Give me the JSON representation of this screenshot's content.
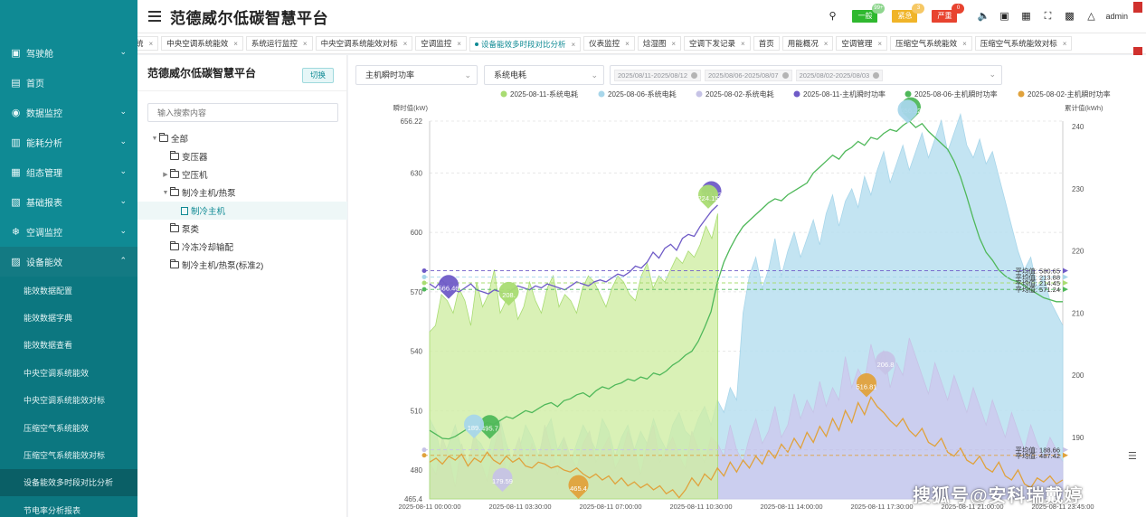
{
  "app": {
    "title": "范德威尔低碳智慧平台"
  },
  "header": {
    "badges": [
      {
        "label": "一般",
        "count": "99+",
        "color": "#2fb82f"
      },
      {
        "label": "紧急",
        "count": "3",
        "color": "#f0b428"
      },
      {
        "label": "严重",
        "count": "0",
        "color": "#e8432f"
      }
    ],
    "user": "admin"
  },
  "sidebar": {
    "items": [
      {
        "label": "驾驶舱",
        "icon": "dashboard-icon",
        "glyph": "▣",
        "expandable": true
      },
      {
        "label": "首页",
        "icon": "home-icon",
        "glyph": "▤",
        "expandable": false
      },
      {
        "label": "数据监控",
        "icon": "monitor-icon",
        "glyph": "◉",
        "expandable": true
      },
      {
        "label": "能耗分析",
        "icon": "bar-chart-icon",
        "glyph": "▥",
        "expandable": true
      },
      {
        "label": "组态管理",
        "icon": "grid-icon",
        "glyph": "▦",
        "expandable": true
      },
      {
        "label": "基础报表",
        "icon": "report-icon",
        "glyph": "▧",
        "expandable": true
      },
      {
        "label": "空调监控",
        "icon": "snowflake-icon",
        "glyph": "❄",
        "expandable": true
      },
      {
        "label": "设备能效",
        "icon": "efficiency-icon",
        "glyph": "▨",
        "expandable": true,
        "open": true
      }
    ],
    "subitems": [
      {
        "label": "能效数据配置"
      },
      {
        "label": "能效数据字典"
      },
      {
        "label": "能效数据查看"
      },
      {
        "label": "中央空调系统能效"
      },
      {
        "label": "中央空调系统能效对标"
      },
      {
        "label": "压缩空气系统能效"
      },
      {
        "label": "压缩空气系统能效对标"
      },
      {
        "label": "设备能效多时段对比分析",
        "active": true
      },
      {
        "label": "节电率分析报表"
      }
    ]
  },
  "tabs": [
    {
      "label": "统"
    },
    {
      "label": "中央空调系统能效"
    },
    {
      "label": "系统运行监控"
    },
    {
      "label": "中央空调系统能效对标"
    },
    {
      "label": "空调监控"
    },
    {
      "label": "设备能效多时段对比分析",
      "active": true
    },
    {
      "label": "仪表监控"
    },
    {
      "label": "焓湿图"
    },
    {
      "label": "空调下发记录"
    },
    {
      "label": "首页",
      "closable": false
    },
    {
      "label": "用能概况"
    },
    {
      "label": "空调管理"
    },
    {
      "label": "压缩空气系统能效"
    },
    {
      "label": "压缩空气系统能效对标"
    }
  ],
  "tree": {
    "title": "范德威尔低碳智慧平台",
    "switch_label": "切换",
    "search_placeholder": "输入搜索内容",
    "nodes": [
      {
        "label": "全部",
        "level": 0,
        "arrow": "▼",
        "type": "folder"
      },
      {
        "label": "变压器",
        "level": 1,
        "arrow": "",
        "type": "folder"
      },
      {
        "label": "空压机",
        "level": 1,
        "arrow": "▶",
        "type": "folder"
      },
      {
        "label": "制冷主机/热泵",
        "level": 1,
        "arrow": "▼",
        "type": "folder"
      },
      {
        "label": "制冷主机",
        "level": 2,
        "arrow": "",
        "type": "file",
        "selected": true
      },
      {
        "label": "泵类",
        "level": 1,
        "arrow": "",
        "type": "folder"
      },
      {
        "label": "冷冻冷却输配",
        "level": 1,
        "arrow": "",
        "type": "folder"
      },
      {
        "label": "制冷主机/热泵(标准2)",
        "level": 1,
        "arrow": "",
        "type": "folder"
      }
    ]
  },
  "filters": {
    "metric1": "主机瞬时功率",
    "metric2": "系统电耗",
    "periods": [
      "2025/08/11-2025/08/12",
      "2025/08/06-2025/08/07",
      "2025/08/02-2025/08/03"
    ]
  },
  "chart_data": {
    "type": "line",
    "left_axis": {
      "label": "瞬时值(kW)",
      "ticks": [
        465.4,
        480,
        510,
        540,
        570,
        600,
        630,
        656.22
      ],
      "min": 465.4,
      "max": 656.22
    },
    "right_axis": {
      "label": "累计值(kWh)",
      "ticks": [
        190,
        200,
        210,
        220,
        230,
        240
      ],
      "min": 180.1,
      "max": 240.9
    },
    "x_ticks": [
      "2025-08-11 00:00:00",
      "2025-08-11 03:30:00",
      "2025-08-11 07:00:00",
      "2025-08-11 10:30:00",
      "2025-08-11 14:00:00",
      "2025-08-11 17:30:00",
      "2025-08-11 21:00:00",
      "2025-08-11 23:45:00"
    ],
    "series": [
      {
        "name": "2025-08-11-系统电耗",
        "axis": "right",
        "style": "area",
        "color": "#a9dc72",
        "fill": "#cfeea4",
        "end": 0.455,
        "y": [
          207,
          208,
          213,
          212,
          210,
          214,
          212,
          208,
          215,
          211,
          213,
          217,
          210,
          212,
          214,
          209,
          211,
          215,
          212,
          210,
          214,
          216,
          211,
          213,
          212,
          210,
          214,
          216,
          215,
          213,
          211,
          214,
          216,
          215,
          213,
          212,
          216,
          218,
          214,
          216,
          215,
          217,
          219,
          218,
          220,
          219,
          221,
          224,
          222,
          226
        ]
      },
      {
        "name": "2025-08-06-系统电耗",
        "axis": "right",
        "style": "area",
        "color": "#a8d6ea",
        "fill": "#b9dff0",
        "y": [
          193,
          191,
          186,
          189,
          192,
          188,
          186,
          190,
          189,
          187,
          191,
          193,
          189,
          186,
          188,
          192,
          190,
          187,
          191,
          193,
          188,
          190,
          186,
          189,
          192,
          190,
          188,
          193,
          191,
          187,
          190,
          192,
          188,
          191,
          189,
          193,
          190,
          188,
          192,
          194,
          191,
          190,
          193,
          195,
          192,
          196,
          194,
          198,
          196,
          210,
          216,
          219,
          214,
          217,
          222,
          216,
          220,
          223,
          219,
          222,
          225,
          221,
          226,
          229,
          224,
          228,
          230,
          227,
          232,
          229,
          233,
          236,
          231,
          234,
          237,
          233,
          236,
          239,
          235,
          238,
          241,
          236,
          239,
          242,
          237,
          235,
          238,
          234,
          236,
          232,
          228,
          224,
          220,
          217,
          219,
          214,
          216,
          212,
          210,
          208
        ]
      },
      {
        "name": "2025-08-02-系统电耗",
        "axis": "right",
        "style": "area",
        "color": "#c6c3e6",
        "fill": "#cdcaee",
        "y": [
          186,
          184,
          190,
          187,
          182,
          189,
          185,
          191,
          186,
          183,
          188,
          192,
          184,
          187,
          190,
          185,
          189,
          186,
          192,
          188,
          184,
          190,
          187,
          185,
          189,
          191,
          186,
          188,
          190,
          185,
          187,
          191,
          188,
          184,
          189,
          192,
          186,
          188,
          190,
          187,
          185,
          191,
          188,
          186,
          190,
          189,
          187,
          192,
          188,
          186,
          190,
          193,
          189,
          191,
          195,
          190,
          192,
          197,
          193,
          196,
          194,
          199,
          195,
          198,
          196,
          203,
          198,
          201,
          199,
          205,
          201,
          204,
          198,
          202,
          200,
          206,
          203,
          200,
          197,
          202,
          199,
          196,
          200,
          197,
          194,
          198,
          195,
          192,
          196,
          193,
          190,
          194,
          191,
          188,
          192,
          189,
          187,
          190,
          188,
          186
        ]
      },
      {
        "name": "2025-08-11-主机瞬时功率",
        "axis": "left",
        "style": "line",
        "color": "#6f5bc7",
        "end": 0.455,
        "y": [
          574,
          572,
          576,
          573,
          571,
          570,
          572,
          574,
          571,
          570,
          569,
          571,
          570,
          569,
          571,
          573,
          572,
          571,
          573,
          572,
          574,
          573,
          572,
          571,
          573,
          575,
          574,
          573,
          575,
          576,
          575,
          577,
          579,
          578,
          580,
          583,
          582,
          585,
          590,
          587,
          592,
          594,
          591,
          597,
          599,
          598,
          603,
          607,
          611,
          613.82
        ]
      },
      {
        "name": "2025-08-06-主机瞬时功率",
        "axis": "left",
        "style": "line",
        "color": "#4fb85a",
        "y": [
          500,
          498,
          496,
          495.7,
          497,
          499,
          501,
          500,
          502,
          504,
          503,
          505,
          507,
          506,
          508,
          510,
          509,
          511,
          513,
          514,
          512,
          515,
          516,
          518,
          519,
          517,
          520,
          522,
          521,
          523,
          524,
          526,
          525,
          527,
          526,
          529,
          528,
          530,
          533,
          535,
          538,
          540,
          545,
          552,
          560,
          575,
          585,
          592,
          598,
          603,
          606,
          609,
          612,
          615,
          617,
          616,
          619,
          621,
          623,
          625,
          630,
          633,
          636,
          639,
          637,
          641,
          643,
          646,
          644,
          648,
          647,
          650,
          652,
          651,
          654,
          656.22,
          653,
          655,
          651,
          648,
          645,
          642,
          636,
          628,
          618,
          607,
          597,
          590,
          586,
          581,
          578,
          576,
          575,
          573,
          571,
          569,
          567,
          566,
          565,
          565
        ]
      },
      {
        "name": "2025-08-02-主机瞬时功率",
        "axis": "left",
        "style": "line",
        "color": "#e0a23c",
        "y": [
          484,
          486,
          483,
          487,
          485,
          488,
          482,
          486,
          484,
          489,
          485,
          483,
          487,
          484,
          486,
          482,
          481,
          484,
          483,
          481,
          482,
          480,
          479,
          481,
          478,
          476,
          478,
          475,
          477,
          473,
          476,
          472,
          474,
          471,
          473,
          470,
          472,
          468,
          470,
          466,
          470,
          476,
          472,
          478,
          475,
          481,
          477,
          484,
          479,
          485,
          481,
          487,
          483,
          490,
          486,
          493,
          489,
          496,
          491,
          499,
          494,
          502,
          497,
          506,
          500,
          510,
          504,
          514,
          508,
          516.81,
          512,
          509,
          505,
          502,
          506,
          500,
          497,
          501,
          494,
          492,
          496,
          489,
          487,
          491,
          485,
          483,
          487,
          481,
          479,
          484,
          477,
          475,
          480,
          473,
          471,
          476,
          474,
          477,
          473,
          475
        ]
      }
    ],
    "markers": [
      {
        "label": "613.82",
        "color": "#6f5bc7",
        "xi": 0.445,
        "axis": "left",
        "v": 613.82
      },
      {
        "label": "566.46",
        "color": "#6f5bc7",
        "xi": 0.03,
        "axis": "left",
        "v": 566.46
      },
      {
        "label": "656.22",
        "color": "#4fb85a",
        "xi": 0.76,
        "axis": "left",
        "v": 656.22
      },
      {
        "label": "495.7",
        "color": "#4fb85a",
        "xi": 0.095,
        "axis": "left",
        "v": 495.7
      },
      {
        "label": "516.81",
        "color": "#e0a23c",
        "xi": 0.69,
        "axis": "left",
        "v": 516.81
      },
      {
        "label": "465.4",
        "color": "#e0a23c",
        "xi": 0.235,
        "axis": "left",
        "v": 465.4
      },
      {
        "label": "189.",
        "color": "#a8d6ea",
        "xi": 0.07,
        "axis": "left",
        "v": 496
      },
      {
        "label": "179.59",
        "color": "#c6c3e6",
        "xi": 0.115,
        "axis": "left",
        "v": 469
      },
      {
        "label": "206.8",
        "color": "#c6c3e6",
        "xi": 0.72,
        "axis": "left",
        "v": 528
      },
      {
        "label": "224.15",
        "color": "#a9dc72",
        "xi": 0.44,
        "axis": "left",
        "v": 612
      },
      {
        "label": "208.",
        "color": "#a9dc72",
        "xi": 0.125,
        "axis": "left",
        "v": 563
      },
      {
        "label": "",
        "color": "#a8d6ea",
        "xi": 0.755,
        "axis": "left",
        "v": 655
      }
    ],
    "avg_lines": [
      {
        "label": "平均值: 580.65",
        "axis": "left",
        "v": 580.65,
        "color": "#6f5bc7"
      },
      {
        "label": "平均值: 213.88",
        "axis": "left",
        "v": 577.5,
        "color": "#a8d6ea"
      },
      {
        "label": "平均值: 214.45",
        "axis": "left",
        "v": 574.5,
        "color": "#a9dc72"
      },
      {
        "label": "平均值: 571.24",
        "axis": "left",
        "v": 571.24,
        "color": "#4fb85a"
      },
      {
        "label": "平均值: 188.66",
        "axis": "left",
        "v": 490.2,
        "color": "#c6c3e6"
      },
      {
        "label": "平均值: 487.42",
        "axis": "left",
        "v": 487.42,
        "color": "#e0a23c"
      }
    ]
  },
  "watermark": "搜狐号@安科瑞戴婷"
}
